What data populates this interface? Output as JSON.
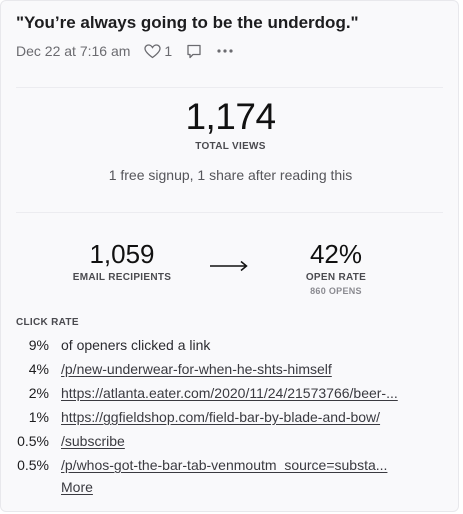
{
  "post": {
    "title": "\"You’re always going to be the underdog.\"",
    "date": "Dec 22 at 7:16 am",
    "likes": "1"
  },
  "icons": {
    "heart": "heart-icon",
    "comment": "comment-icon",
    "more": "more-icon"
  },
  "total_views": {
    "value": "1,174",
    "label": "TOTAL VIEWS",
    "summary": "1 free signup, 1 share after reading this"
  },
  "email": {
    "recipients_value": "1,059",
    "recipients_label": "EMAIL RECIPIENTS",
    "open_rate_value": "42%",
    "open_rate_label": "OPEN RATE",
    "opens_label": "860 OPENS"
  },
  "click_rate": {
    "label": "CLICK RATE",
    "rows": [
      {
        "pct": "9%",
        "text": "of openers clicked a link",
        "link": false
      },
      {
        "pct": "4%",
        "text": "/p/new-underwear-for-when-he-shts-himself",
        "link": true
      },
      {
        "pct": "2%",
        "text": "https://atlanta.eater.com/2020/11/24/21573766/beer-...",
        "link": true
      },
      {
        "pct": "1%",
        "text": "https://ggfieldshop.com/field-bar-by-blade-and-bow/",
        "link": true
      },
      {
        "pct": "0.5%",
        "text": "/subscribe",
        "link": true
      },
      {
        "pct": "0.5%",
        "text": "/p/whos-got-the-bar-tab-venmoutm_source=substa...",
        "link": true
      }
    ],
    "more_label": "More"
  },
  "colors": {
    "card_bg": "#f9f9fb",
    "text_dark": "#1d1d1f",
    "text_muted": "#6b6b70"
  }
}
